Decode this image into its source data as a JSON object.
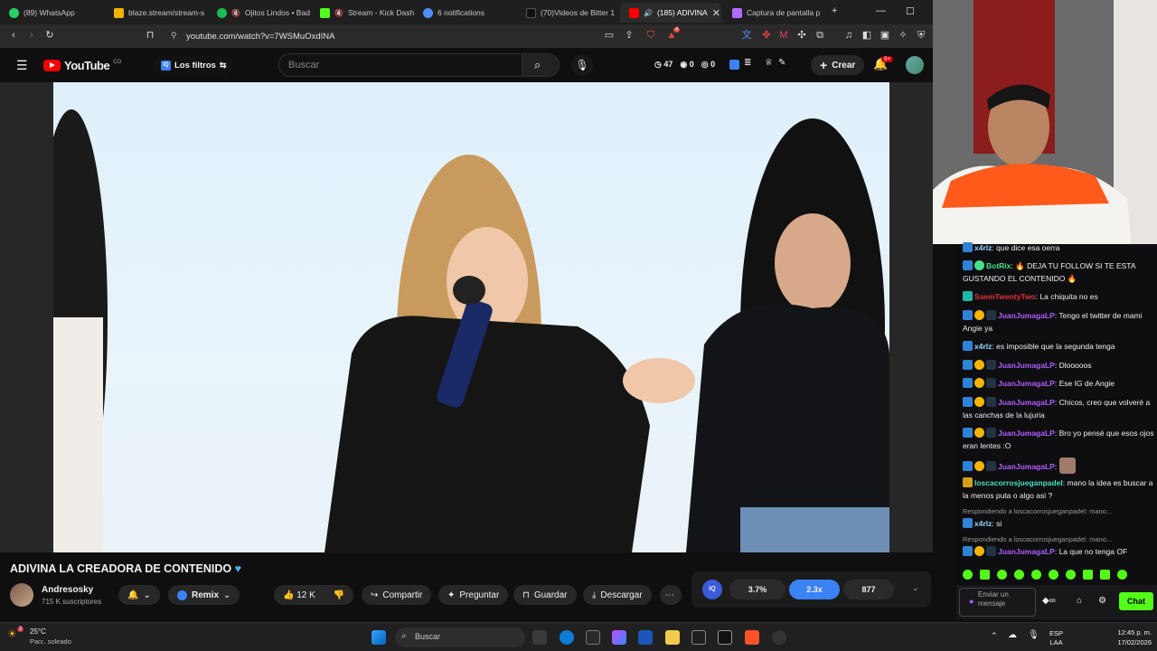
{
  "browser": {
    "tabs": [
      {
        "label": "(89) WhatsApp",
        "color": "#25d366"
      },
      {
        "label": "blaze.stream/stream-s",
        "color": "#f0b400"
      },
      {
        "label": "Ojitos Lindos • Bad",
        "color": "#1db954"
      },
      {
        "label": "Stream - Kick Dash",
        "color": "#53fc18"
      },
      {
        "label": "6 notifications",
        "color": "#4d90fe"
      },
      {
        "label": "(70)Videos de Bitter 1",
        "color": "#ffffff"
      },
      {
        "label": "(185) ADIVINA",
        "color": "#ff0000"
      },
      {
        "label": "Captura de pantalla p",
        "color": "#b36bff"
      }
    ],
    "url": "youtube.com/watch?v=7WSMuOxdINA",
    "shield_badge": "4"
  },
  "youtube": {
    "logo_text": "YouTube",
    "country": "CO",
    "filters_label": "Los filtros",
    "search_placeholder": "Buscar",
    "stats": [
      "47",
      "0",
      "0"
    ],
    "create_label": "Crear",
    "notif_badge": "9+",
    "video_title": "ADIVINA LA CREADORA DE CONTENIDO",
    "channel_name": "Andresosky",
    "subscribers": "715 K suscriptores",
    "remix_label": "Remix",
    "likes": "12 K",
    "share_label": "Compartir",
    "ask_label": "Preguntar",
    "save_label": "Guardar",
    "download_label": "Descargar",
    "ext_stats": [
      "3.7%",
      "2.3x",
      "877"
    ]
  },
  "chat": {
    "messages": [
      {
        "user": "x4rlz",
        "text": "que dice esa oerra",
        "color": "#9ad2ff"
      },
      {
        "user": "BotRix",
        "text": "🔥 DEJA TU FOLLOW SI TE ESTA GUSTANDO EL CONTENIDO 🔥",
        "color": "#46e08a"
      },
      {
        "user": "SaemTwentyTwo",
        "text": "La chiquita no es",
        "color": "#e0323a"
      },
      {
        "user": "JuanJumagaLP",
        "text": "Tengo el twitter de mami Angie ya",
        "color": "#b05cff"
      },
      {
        "user": "x4rlz",
        "text": "es imposible que la segunda tenga",
        "color": "#9ad2ff"
      },
      {
        "user": "JuanJumagaLP",
        "text": "Dlooooos",
        "color": "#b05cff"
      },
      {
        "user": "JuanJumagaLP",
        "text": "Ese IG de Angie",
        "color": "#b05cff"
      },
      {
        "user": "JuanJumagaLP",
        "text": "Chicos, creo que volveré a las canchas de la lujuria",
        "color": "#b05cff"
      },
      {
        "user": "JuanJumagaLP",
        "text": "Bro yo pensé que esos ojos eran lentes :O",
        "color": "#b05cff"
      },
      {
        "user": "JuanJumagaLP",
        "text": "",
        "color": "#b05cff"
      },
      {
        "user": "loscacorrosjueganpadel",
        "text": "mano la idea es buscar a la menos puta o algo asi ?",
        "color": "#46e0c0"
      },
      {
        "user": "x4rlz",
        "text": "si",
        "color": "#9ad2ff"
      },
      {
        "user": "JuanJumagaLP",
        "text": "La que no tenga OF",
        "color": "#b05cff"
      }
    ],
    "reply1": "Respondiendo a loscacorrosjueganpadel: mano...",
    "reply2": "Respondiendo a loscacorrosjueganpadel: mano...",
    "input_placeholder": "Enviar un mensaje",
    "chat_button": "Chat"
  },
  "taskbar": {
    "temp": "25°C",
    "weather": "Parc. soleado",
    "weather_badge": "3",
    "search_placeholder": "Buscar",
    "lang1": "ESP",
    "lang2": "LAA",
    "time": "12:45 p. m.",
    "date": "17/02/2026"
  }
}
